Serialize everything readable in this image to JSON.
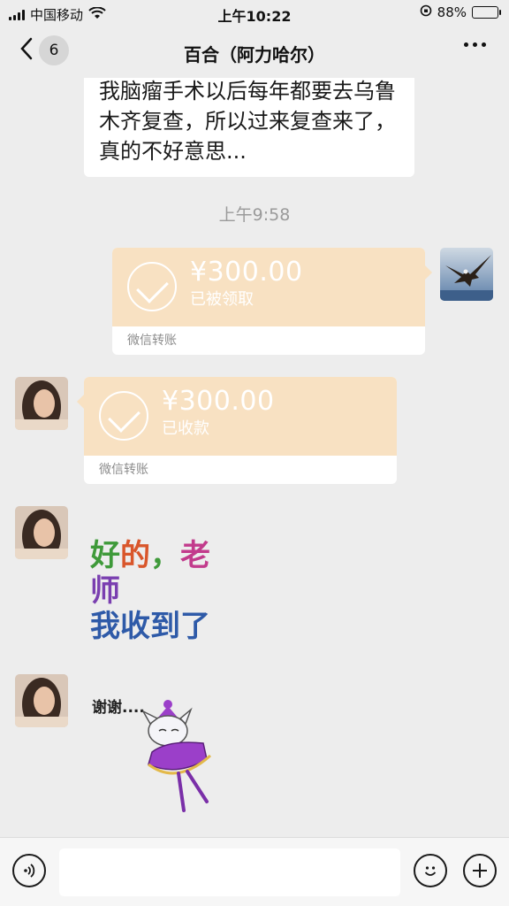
{
  "status_bar": {
    "carrier": "中国移动",
    "time": "上午10:22",
    "battery": "88%",
    "battery_level": 0.88,
    "icons": [
      "signal-icon",
      "wifi-icon",
      "rotation-lock-icon",
      "battery-icon"
    ]
  },
  "nav": {
    "unread_count": "6",
    "title": "百合（阿力哈尔）",
    "icons": [
      "back-chevron-icon",
      "more-icon"
    ]
  },
  "messages": {
    "text_message": "我脑瘤手术以后每年都要去乌鲁木齐复查，所以过来复查来了，真的不好意思...",
    "timestamp": "上午9:58",
    "transfer_sent": {
      "amount": "¥300.00",
      "status": "已被领取",
      "label": "微信转账"
    },
    "transfer_received": {
      "amount": "¥300.00",
      "status": "已收款",
      "label": "微信转账"
    },
    "sticker_1": {
      "line1": [
        "好",
        "的",
        "，",
        "老",
        "师"
      ],
      "line2": "我收到了",
      "colors": [
        "#3f9a3a",
        "#d9562b",
        "#c23b8c",
        "#7a3fb0",
        "#2e5aa8"
      ]
    },
    "sticker_2": {
      "text": "谢谢...."
    }
  },
  "input_bar": {
    "placeholder": "",
    "icons": [
      "voice-icon",
      "emoji-icon",
      "plus-icon"
    ]
  },
  "colors": {
    "background": "#ededed",
    "transfer_card": "#f8e1c2",
    "bubble": "#ffffff",
    "timestamp": "#9a9a9a"
  }
}
